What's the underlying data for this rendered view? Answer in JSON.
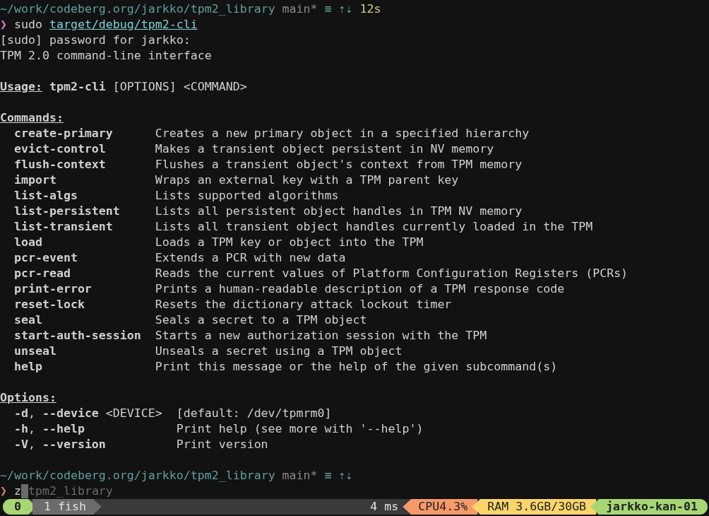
{
  "prompt_top": {
    "path": "~/work/codeberg.org/jarkko/tpm2_library",
    "branch": "main*",
    "git_status": "≡ ⇡⇣",
    "duration": "12s"
  },
  "command": {
    "symbol": "❯",
    "color": "#d77fbf",
    "program": "sudo",
    "argument": "target/debug/tpm2-cli"
  },
  "output": [
    "[sudo] password for jarkko:",
    "TPM 2.0 command-line interface"
  ],
  "usage": {
    "heading": "Usage:",
    "program": "tpm2-cli",
    "args": "[OPTIONS] <COMMAND>"
  },
  "commands_heading": "Commands:",
  "commands": [
    {
      "name": "create-primary",
      "description": "Creates a new primary object in a specified hierarchy"
    },
    {
      "name": "evict-control",
      "description": "Makes a transient object persistent in NV memory"
    },
    {
      "name": "flush-context",
      "description": "Flushes a transient object's context from TPM memory"
    },
    {
      "name": "import",
      "description": "Wraps an external key with a TPM parent key"
    },
    {
      "name": "list-algs",
      "description": "Lists supported algorithms"
    },
    {
      "name": "list-persistent",
      "description": "Lists all persistent object handles in TPM NV memory"
    },
    {
      "name": "list-transient",
      "description": "Lists all transient object handles currently loaded in the TPM"
    },
    {
      "name": "load",
      "description": "Loads a TPM key or object into the TPM"
    },
    {
      "name": "pcr-event",
      "description": "Extends a PCR with new data"
    },
    {
      "name": "pcr-read",
      "description": "Reads the current values of Platform Configuration Registers (PCRs)"
    },
    {
      "name": "print-error",
      "description": "Prints a human-readable description of a TPM response code"
    },
    {
      "name": "reset-lock",
      "description": "Resets the dictionary attack lockout timer"
    },
    {
      "name": "seal",
      "description": "Seals a secret to a TPM object"
    },
    {
      "name": "start-auth-session",
      "description": "Starts a new authorization session with the TPM"
    },
    {
      "name": "unseal",
      "description": "Unseals a secret using a TPM object"
    },
    {
      "name": "help",
      "description": "Print this message or the help of the given subcommand(s)"
    }
  ],
  "options_heading": "Options:",
  "options": [
    {
      "flags": "**-d**, **--device** <DEVICE>",
      "description": "[default: /dev/tpmrm0]"
    },
    {
      "flags": "**-h**, **--help**",
      "description": "Print help (see more with '--help')"
    },
    {
      "flags": "**-V**, **--version**",
      "description": "Print version"
    }
  ],
  "prompt_bottom": {
    "path": "~/work/codeberg.org/jarkko/tpm2_library",
    "branch": "main*",
    "git_status": "≡ ⇡⇣"
  },
  "input": {
    "symbol": "❯",
    "color": "#d77f7f",
    "value": "z",
    "suggestion": "tpm2_library"
  },
  "status_bar": {
    "left": [
      {
        "text": "0",
        "color": "#a6d774"
      },
      {
        "text": "1 fish",
        "color": "#6c6c6c"
      }
    ],
    "right": [
      {
        "text": "4 ms",
        "color": "#3a3a3a"
      },
      {
        "text": "CPU4.3%",
        "color": "#f79a6a"
      },
      {
        "text": "RAM 3.6GB/30GB",
        "color": "#fcd56a"
      },
      {
        "text": "jarkko-kan-01",
        "color": "#a6d774"
      }
    ]
  }
}
